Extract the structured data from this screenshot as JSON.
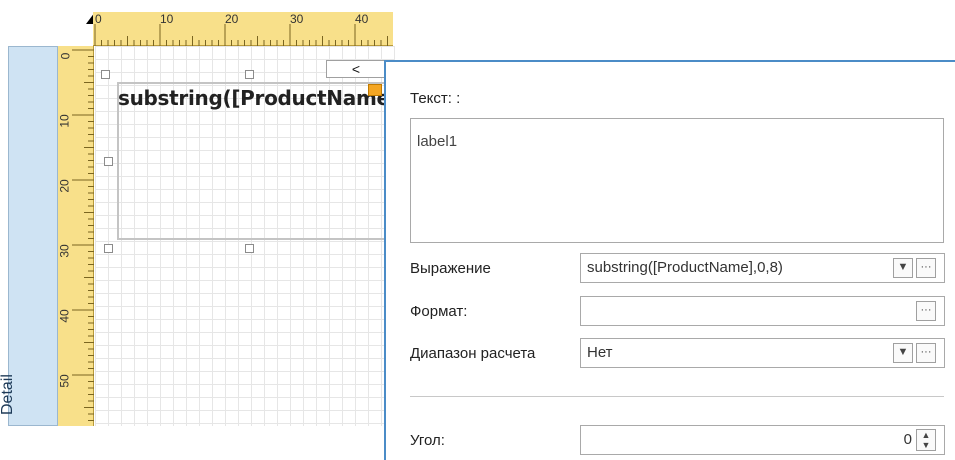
{
  "ruler": {
    "top_ticks": [
      "0",
      "10",
      "20",
      "30",
      "40"
    ],
    "left_ticks": [
      "0",
      "10",
      "20",
      "30",
      "40",
      "50"
    ]
  },
  "band": {
    "label": "Detail"
  },
  "design": {
    "label_text": "substring([ProductName],",
    "collapse_symbol": "<"
  },
  "panel": {
    "text_label": "Текст: :",
    "text_value": "label1",
    "expression_label": "Выражение",
    "expression_value": "substring([ProductName],0,8)",
    "format_label": "Формат:",
    "format_value": "",
    "range_label": "Диапазон расчета",
    "range_value": "Нет",
    "angle_label": "Угол:",
    "angle_value": "0"
  },
  "colors": {
    "ruler": "#f8e08a",
    "band": "#cfe3f3",
    "panel_border": "#4b8cc7",
    "smart_tag": "#f4a623"
  }
}
